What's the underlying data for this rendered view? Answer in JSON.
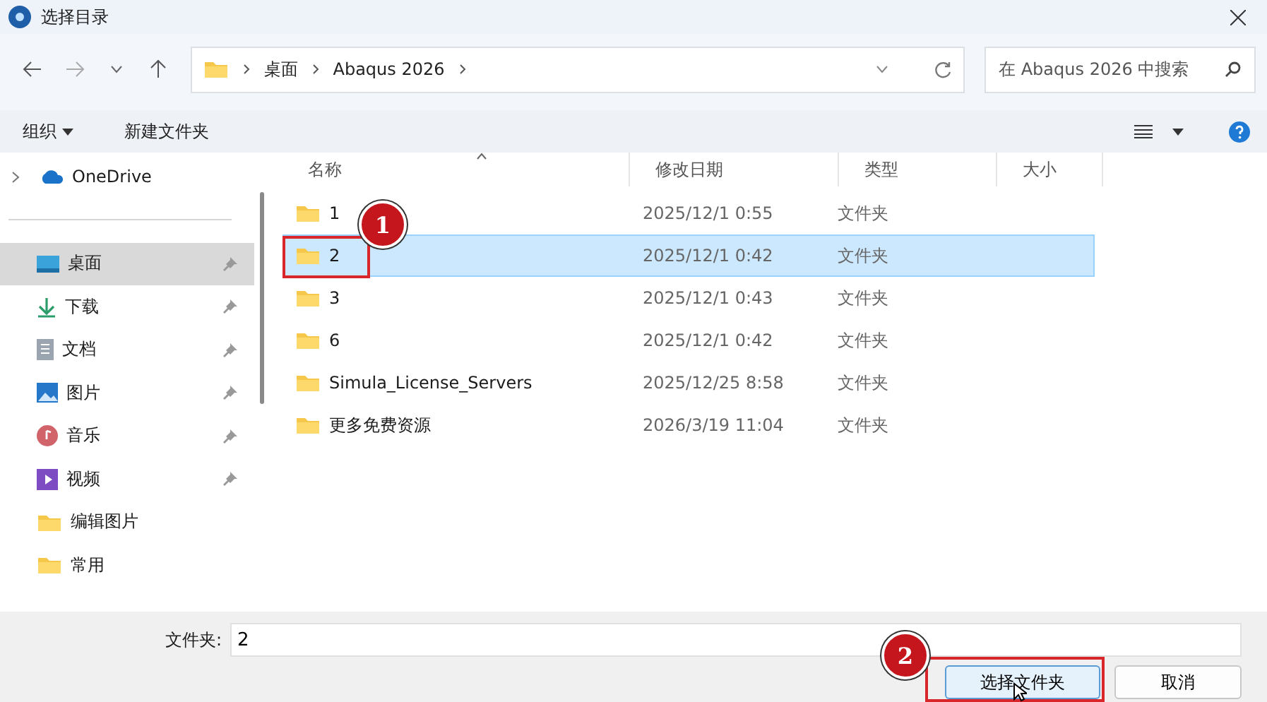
{
  "window": {
    "title": "选择目录"
  },
  "address": {
    "crumbs": [
      "桌面",
      "Abaqus 2026"
    ]
  },
  "search": {
    "placeholder": "在 Abaqus 2026 中搜索"
  },
  "toolbar": {
    "organize": "组织",
    "new_folder": "新建文件夹"
  },
  "sidebar": {
    "top": {
      "label": "OneDrive",
      "expanded": false
    },
    "items": [
      {
        "label": "桌面",
        "kind": "desktop",
        "pinned": true,
        "selected": true
      },
      {
        "label": "下载",
        "kind": "download",
        "pinned": true,
        "selected": false
      },
      {
        "label": "文档",
        "kind": "documents",
        "pinned": true,
        "selected": false
      },
      {
        "label": "图片",
        "kind": "pictures",
        "pinned": true,
        "selected": false
      },
      {
        "label": "音乐",
        "kind": "music",
        "pinned": true,
        "selected": false
      },
      {
        "label": "视频",
        "kind": "videos",
        "pinned": true,
        "selected": false
      },
      {
        "label": "编辑图片",
        "kind": "folder",
        "pinned": false,
        "selected": false
      },
      {
        "label": "常用",
        "kind": "folder",
        "pinned": false,
        "selected": false
      }
    ]
  },
  "table": {
    "columns": [
      "名称",
      "修改日期",
      "类型",
      "大小"
    ],
    "rows": [
      {
        "name": "1",
        "date": "2025/12/1 0:55",
        "type": "文件夹",
        "selected": false
      },
      {
        "name": "2",
        "date": "2025/12/1 0:42",
        "type": "文件夹",
        "selected": true,
        "callout": "1"
      },
      {
        "name": "3",
        "date": "2025/12/1 0:43",
        "type": "文件夹",
        "selected": false
      },
      {
        "name": "6",
        "date": "2025/12/1 0:42",
        "type": "文件夹",
        "selected": false
      },
      {
        "name": "Simula_License_Servers",
        "date": "2025/12/25 8:58",
        "type": "文件夹",
        "selected": false
      },
      {
        "name": "更多免费资源",
        "date": "2026/3/19 11:04",
        "type": "文件夹",
        "selected": false
      }
    ]
  },
  "footer": {
    "folder_label": "文件夹:",
    "folder_value": "2",
    "select_button": {
      "label": "选择文件夹",
      "callout": "2"
    },
    "cancel_button": "取消"
  }
}
